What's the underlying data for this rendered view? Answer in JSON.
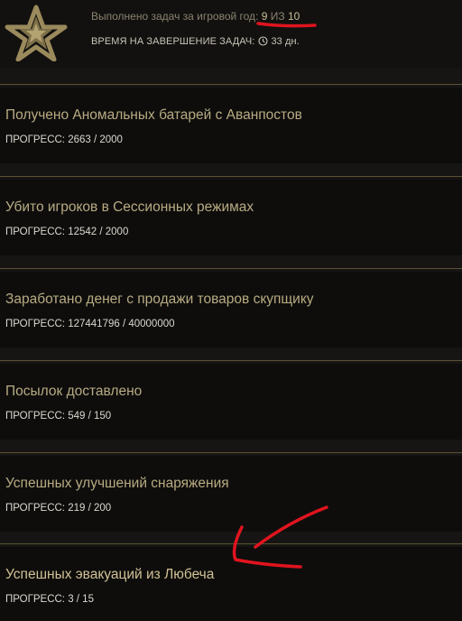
{
  "header": {
    "tasks_label": "Выполнено задач за игровой год:",
    "tasks_done": "9",
    "tasks_of": "ИЗ",
    "tasks_total": "10",
    "time_label": "ВРЕМЯ НА ЗАВЕРШЕНИЕ ЗАДАЧ:",
    "time_value": "33 дн."
  },
  "tasks": [
    {
      "title": "Получено Аномальных батарей с Аванпостов",
      "progress": "ПРОГРЕСС: 2663 / 2000"
    },
    {
      "title": "Убито игроков в Сессионных режимах",
      "progress": "ПРОГРЕСС: 12542 / 2000"
    },
    {
      "title": "Заработано денег с продажи товаров скупщику",
      "progress": "ПРОГРЕСС: 127441796 / 40000000"
    },
    {
      "title": "Посылок доставлено",
      "progress": "ПРОГРЕСС: 549 / 150"
    },
    {
      "title": "Успешных улучшений снаряжения",
      "progress": "ПРОГРЕСС: 219 / 200"
    },
    {
      "title": "Успешных эвакуаций из Любеча",
      "progress": "ПРОГРЕСС: 3 / 15"
    }
  ],
  "colors": {
    "background": "#161513",
    "card": "#0e0d0c",
    "accent_gold": "#b8ab82",
    "separator": "#5a5235",
    "annotation_red": "#e0141e"
  },
  "icons": {
    "emblem": "star-emblem-icon",
    "clock": "clock-icon",
    "annotation": "red-arrow-annotation"
  }
}
